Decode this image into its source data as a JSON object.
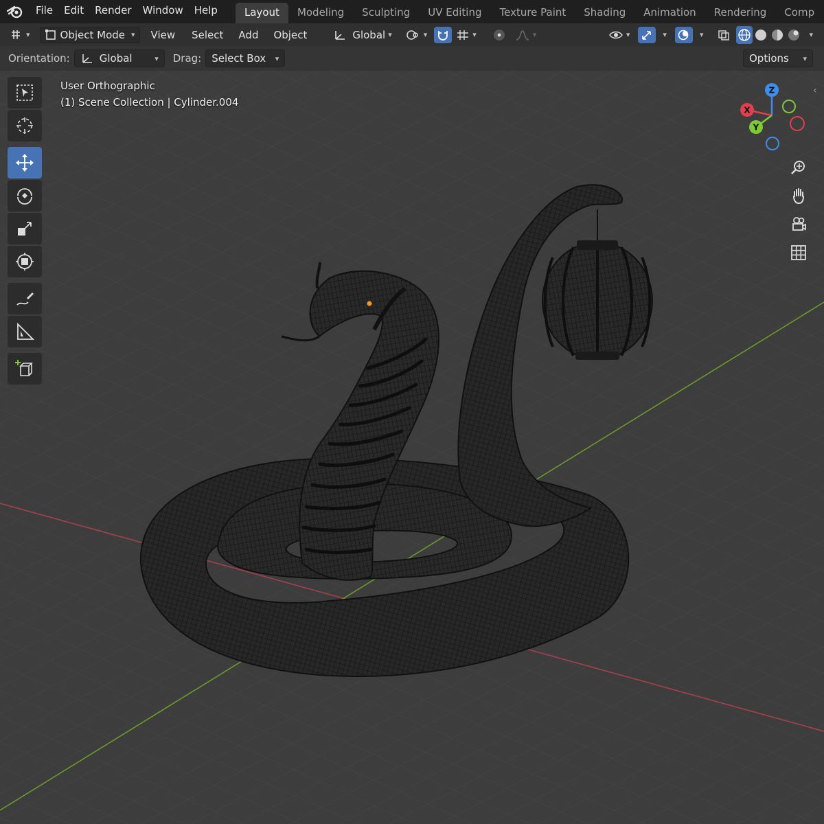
{
  "menu": {
    "items": [
      "File",
      "Edit",
      "Render",
      "Window",
      "Help"
    ]
  },
  "workspaces": {
    "tabs": [
      "Layout",
      "Modeling",
      "Sculpting",
      "UV Editing",
      "Texture Paint",
      "Shading",
      "Animation",
      "Rendering",
      "Comp"
    ],
    "active": "Layout"
  },
  "header": {
    "mode": "Object Mode",
    "view": "View",
    "select": "Select",
    "add": "Add",
    "object": "Object",
    "transform_orientation": "Global"
  },
  "tool_settings": {
    "orientation_label": "Orientation:",
    "orientation_value": "Global",
    "drag_label": "Drag:",
    "drag_value": "Select Box",
    "options": "Options"
  },
  "viewport": {
    "view_name": "User Orthographic",
    "collection_info": "(1) Scene Collection | Cylinder.004"
  },
  "gizmo": {
    "x": "X",
    "y": "Y",
    "z": "Z",
    "x_color": "#e0414f",
    "y_color": "#7ec935",
    "z_color": "#3f8ceb"
  },
  "toolbar": {
    "tools": [
      "select-box-icon",
      "cursor-icon",
      "move-icon",
      "rotate-icon",
      "scale-icon",
      "transform-icon",
      "annotate-icon",
      "measure-icon",
      "add-cube-icon"
    ],
    "active": "move-icon"
  },
  "colors": {
    "accent": "#4772b3",
    "x_axis": "#a5414a",
    "y_axis": "#6b9a2b",
    "grid": "#4a4a4a"
  }
}
